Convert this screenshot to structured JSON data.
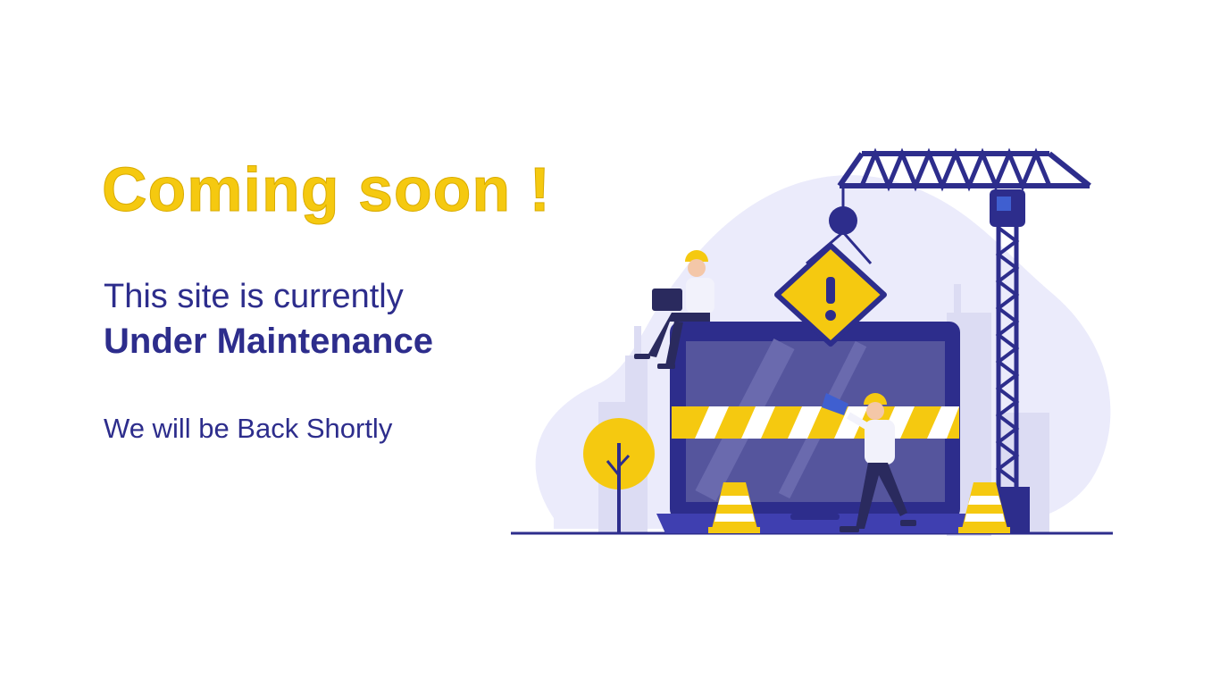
{
  "headline": "Coming soon !",
  "message": {
    "line1": "This site is currently",
    "line2": "Under Maintenance",
    "line3": "We will be Back Shortly"
  },
  "illustration": {
    "scene": "maintenance-construction",
    "icons": [
      "crane-icon",
      "warning-sign-icon",
      "laptop-icon",
      "worker-icon",
      "traffic-cone-icon",
      "tree-icon",
      "megaphone-icon"
    ]
  },
  "colors": {
    "accent_yellow": "#f5c910",
    "brand_navy": "#2d2d8c",
    "blob_lavender": "#ebebfb",
    "building_grey": "#dcdcf3"
  }
}
